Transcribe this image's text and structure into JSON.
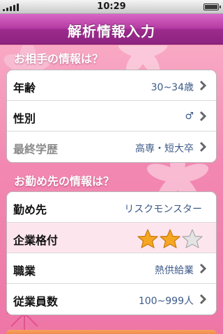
{
  "status_bar": {
    "time": "10:29"
  },
  "nav": {
    "title": "解析情報入力"
  },
  "partner_section": {
    "header": "お相手の情報は？",
    "rows": [
      {
        "label": "年齢",
        "value": "30~34歳"
      },
      {
        "label": "性別",
        "value": "♂"
      },
      {
        "label": "最終学歴",
        "value": "高専・短大卒"
      }
    ]
  },
  "work_section": {
    "header": "お勤め先の情報は？",
    "rows": [
      {
        "label": "勤め先",
        "value": "リスクモンスター"
      },
      {
        "label": "企業格付",
        "rating": 2,
        "rating_max": 3
      },
      {
        "label": "職業",
        "value": "熱供給業"
      },
      {
        "label": "従業員数",
        "value": "100~999人"
      }
    ]
  },
  "colors": {
    "nav": "#b43aa3",
    "background": "#f289b2",
    "value_text": "#3d5a8a",
    "star_filled": "#f5a623",
    "star_empty": "#e4e4e4"
  },
  "icons": [
    "chevron-right-icon",
    "star-icon",
    "signal-icon",
    "battery-icon"
  ]
}
